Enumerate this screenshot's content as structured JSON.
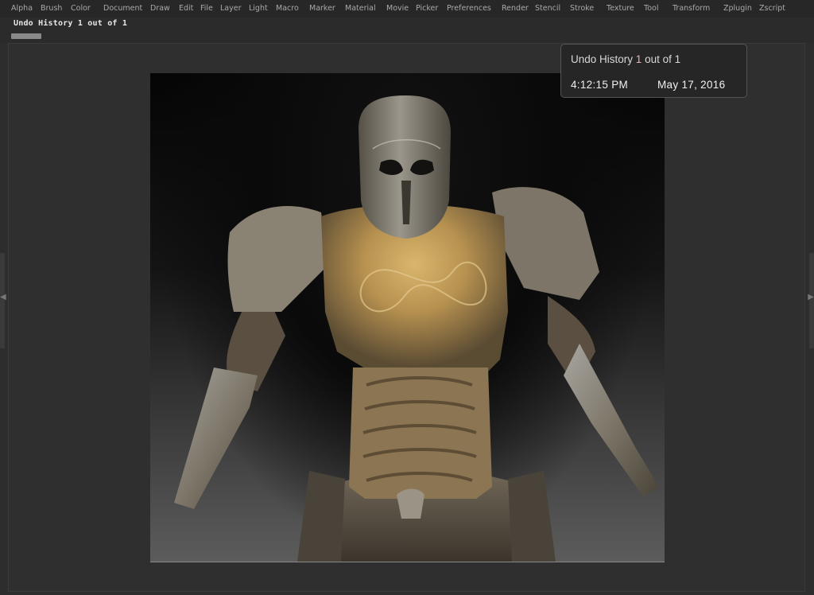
{
  "menu": {
    "items": [
      "Alpha",
      "Brush",
      "Color",
      "Document",
      "Draw",
      "Edit",
      "File",
      "Layer",
      "Light",
      "Macro",
      "Marker",
      "Material",
      "Movie",
      "Picker",
      "Preferences",
      "Render",
      "Stencil",
      "Stroke",
      "Texture",
      "Tool",
      "Transform",
      "Zplugin",
      "Zscript"
    ]
  },
  "undo_bar": {
    "title": "Undo History 1 out of 1",
    "position": 1,
    "total": 1
  },
  "tooltip": {
    "prefix": "Undo History",
    "current": "1",
    "middle": "out of",
    "total": "1",
    "time": "4:12:15 PM",
    "date": "May 17, 2016"
  },
  "canvas": {
    "subject": "armored-warrior-sculpt"
  },
  "colors": {
    "armor_gold": "#c9a560",
    "armor_steel": "#8a8170",
    "background": "#2d2d2d"
  }
}
